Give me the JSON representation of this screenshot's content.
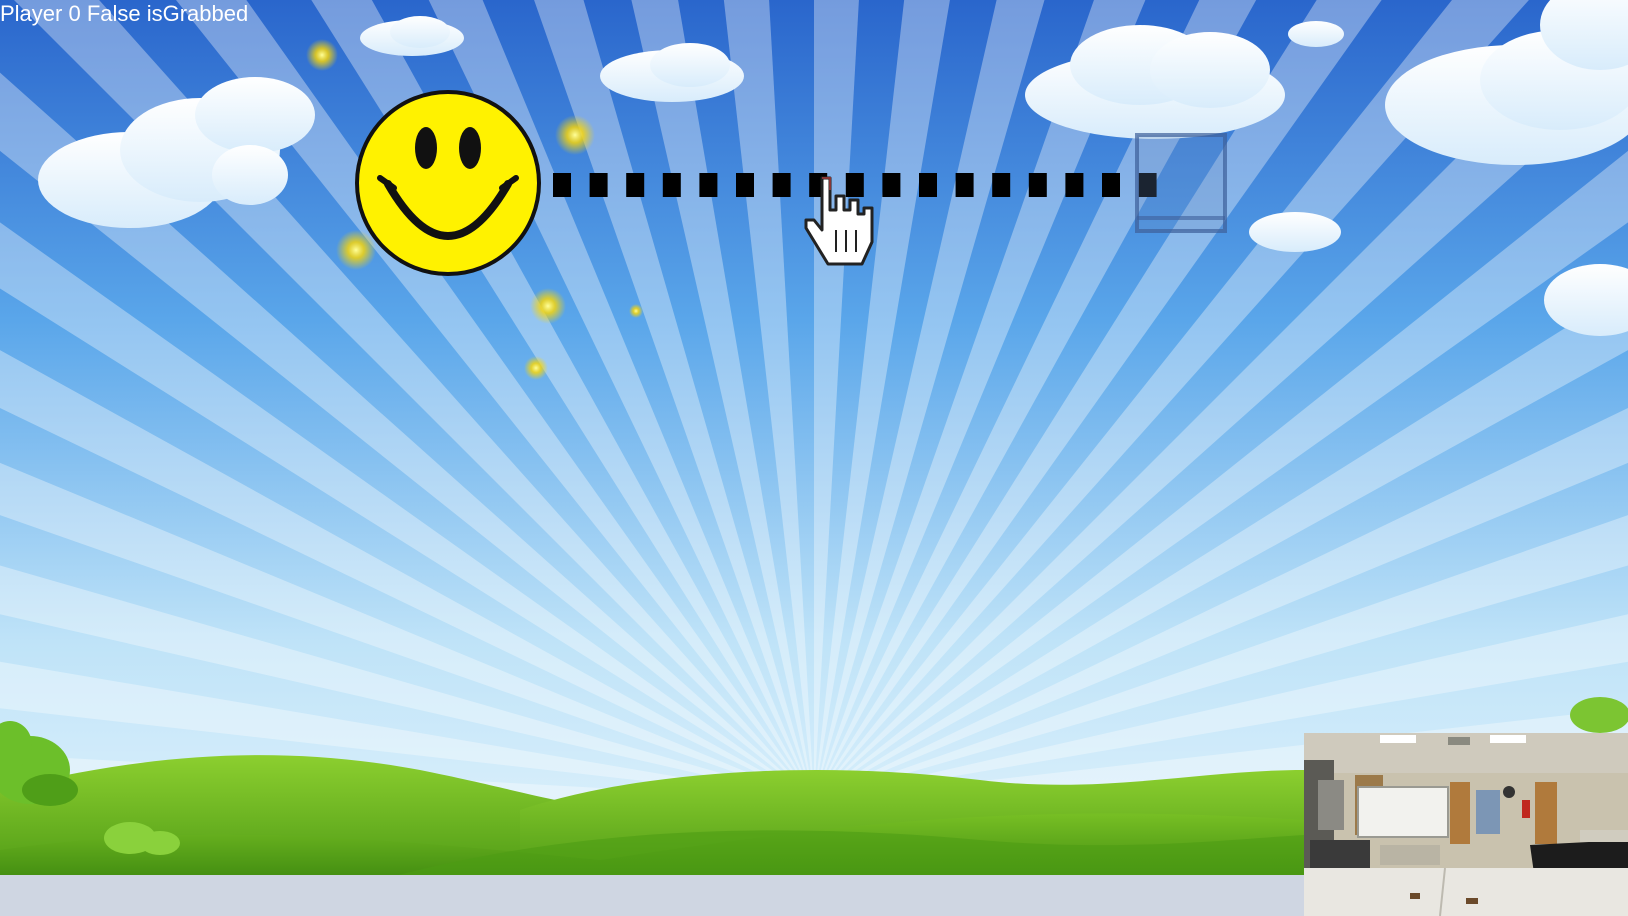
{
  "hud": {
    "debug_text": "Player 0 False isGrabbed"
  },
  "game": {
    "player_icon": "smiley-face-icon",
    "cursor_icon": "hand-pointer-icon",
    "target_icon": "square-target-icon",
    "line_style": "dashed"
  },
  "webcam": {
    "icon": "webcam-feed"
  },
  "colors": {
    "sky_top": "#2d6cd0",
    "sky_bottom": "#d6eefb",
    "hill_green": "#5fae1e",
    "smiley_yellow": "#fff200",
    "ground": "#cbd3e0"
  }
}
